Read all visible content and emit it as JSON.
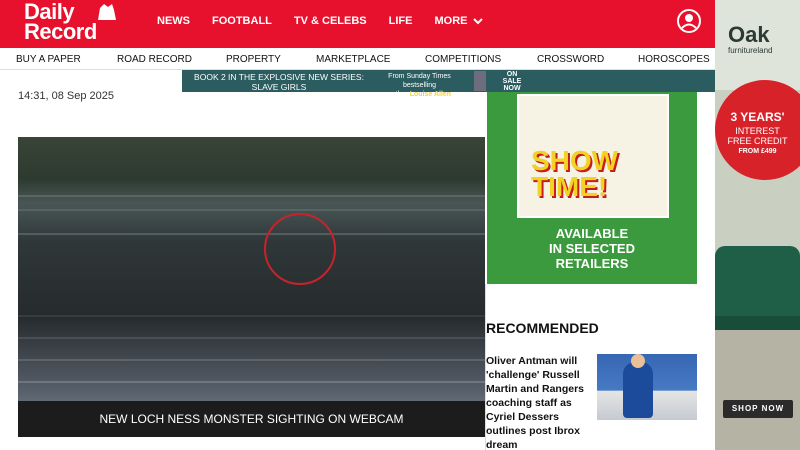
{
  "header": {
    "logo_line1": "Daily",
    "logo_line2": "Record",
    "nav": [
      "NEWS",
      "FOOTBALL",
      "TV & CELEBS",
      "LIFE",
      "MORE"
    ]
  },
  "subnav": [
    "BUY A PAPER",
    "ROAD RECORD",
    "PROPERTY",
    "MARKETPLACE",
    "COMPETITIONS",
    "CROSSWORD",
    "HOROSCOPES"
  ],
  "promo": {
    "line1": "BOOK 2 IN THE EXPLOSIVE NEW SERIES:",
    "line2": "SLAVE GIRLS",
    "mid1": "From Sunday Times bestselling",
    "mid2_prefix": "author ",
    "mid2_author": "Louise Allen",
    "sale": "ON SALE NOW"
  },
  "article": {
    "timestamp": "14:31, 08 Sep 2025",
    "video_caption": "NEW LOCH NESS MONSTER SIGHTING ON WEBCAM"
  },
  "magazine": {
    "cover_text": "SHOW TIME!",
    "line1": "AVAILABLE",
    "line2": "IN SELECTED",
    "line3": "RETAILERS"
  },
  "recommended": {
    "title": "RECOMMENDED",
    "story": "Oliver Antman will 'challenge' Russell Martin and Rangers coaching staff as Cyriel Dessers outlines post Ibrox dream"
  },
  "ad": {
    "brand": "Oak",
    "brand_sub": "furnitureland",
    "offer1": "3 YEARS'",
    "offer2": "INTEREST",
    "offer3": "FREE CREDIT",
    "offer4": "FROM £499",
    "cta": "SHOP NOW"
  },
  "colors": {
    "brand_red": "#e8112d",
    "promo_teal": "#2b5c5f",
    "magazine_green": "#3c9a3e",
    "circle_red": "#c8232c"
  }
}
